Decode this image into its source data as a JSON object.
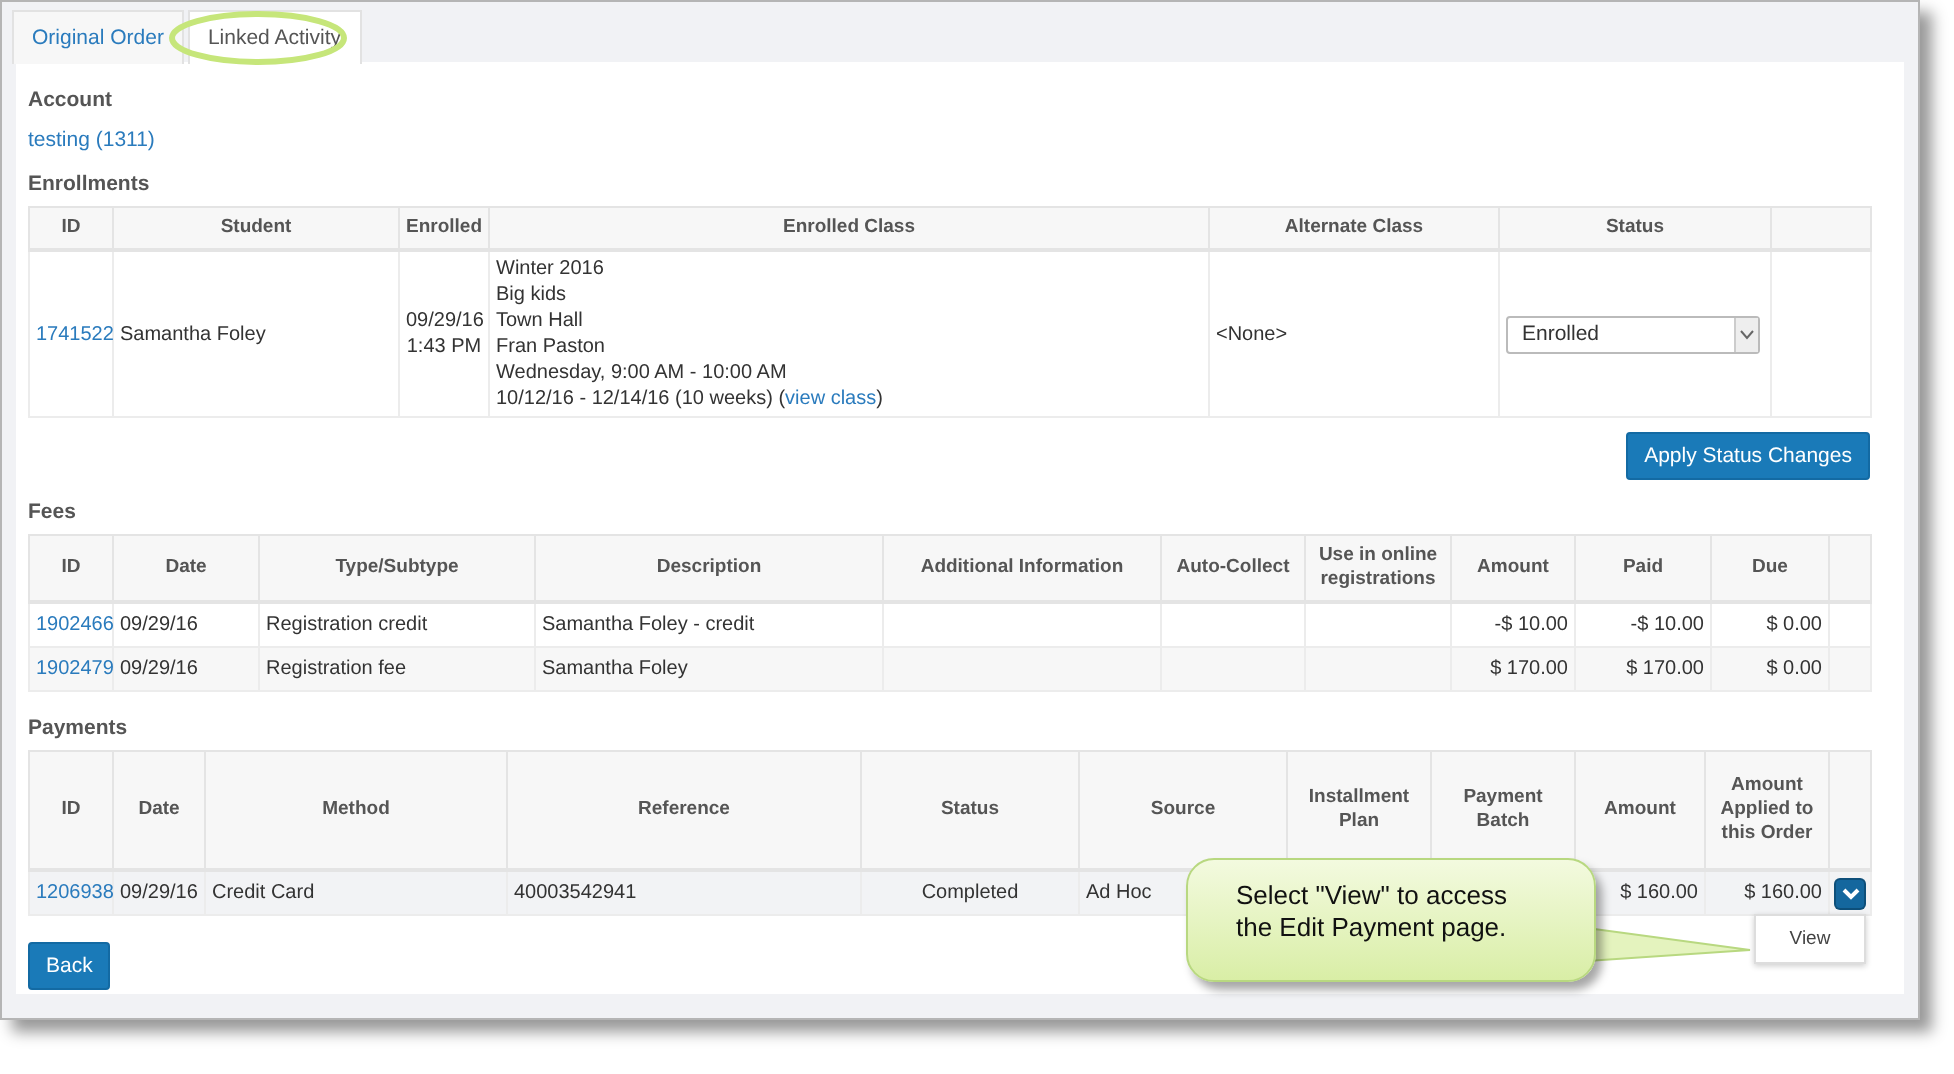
{
  "tabs": [
    {
      "label": "Original Order",
      "selected": false
    },
    {
      "label": "Linked Activity",
      "selected": true
    }
  ],
  "account": {
    "heading": "Account",
    "link": "testing (1311)"
  },
  "enrollments": {
    "heading": "Enrollments",
    "columns": [
      "ID",
      "Student",
      "Enrolled",
      "Enrolled Class",
      "Alternate Class",
      "Status"
    ],
    "rows": [
      {
        "id": "1741522",
        "student": "Samantha Foley",
        "enrolled": [
          "09/29/16",
          "1:43 PM"
        ],
        "enrolled_class": [
          "Winter 2016",
          "Big kids",
          "Town Hall",
          "Fran Paston",
          "Wednesday, 9:00 AM - 10:00 AM"
        ],
        "schedule": "10/12/16 - 12/14/16 (10 weeks) (",
        "class_link": "view class",
        "schedule_end": ")",
        "alternate_class": "<None>",
        "status": "Enrolled"
      }
    ],
    "apply_button": "Apply Status Changes"
  },
  "fees": {
    "heading": "Fees",
    "columns": [
      "ID",
      "Date",
      "Type/Subtype",
      "Description",
      "Additional Information",
      "Auto-Collect",
      "Use in online registrations",
      "Amount",
      "Paid",
      "Due"
    ],
    "rows": [
      {
        "id": "1902466",
        "date": "09/29/16",
        "type": "Registration credit",
        "description": "Samantha Foley - credit",
        "amount": "-$ 10.00",
        "paid": "-$ 10.00",
        "due": "$ 0.00"
      },
      {
        "id": "1902479",
        "date": "09/29/16",
        "type": "Registration fee",
        "description": "Samantha Foley",
        "amount": "$ 170.00",
        "paid": "$ 170.00",
        "due": "$ 0.00"
      }
    ]
  },
  "payments": {
    "heading": "Payments",
    "columns": [
      "ID",
      "Date",
      "Method",
      "Reference",
      "Status",
      "Source",
      "Installment Plan",
      "Payment Batch",
      "Amount",
      "Amount Applied to this Order"
    ],
    "rows": [
      {
        "id": "1206938",
        "date": "09/29/16",
        "method": "Credit Card",
        "reference": "40003542941",
        "status": "Completed",
        "source": "Ad Hoc",
        "amount": "$ 160.00",
        "applied": "$ 160.00",
        "menu": {
          "expanded": true,
          "items": [
            "View"
          ]
        }
      }
    ]
  },
  "back_button": "Back",
  "callout": {
    "text": "Select \"View\" to access the Edit Payment page."
  }
}
